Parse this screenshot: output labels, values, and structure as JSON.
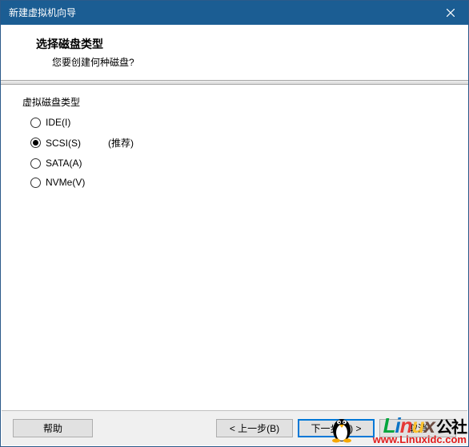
{
  "window": {
    "title": "新建虚拟机向导"
  },
  "header": {
    "title": "选择磁盘类型",
    "subtitle": "您要创建何种磁盘?"
  },
  "group": {
    "label": "虚拟磁盘类型"
  },
  "options": {
    "ide": {
      "label": "IDE(I)",
      "extra": "",
      "selected": false
    },
    "scsi": {
      "label": "SCSI(S)",
      "extra": "(推荐)",
      "selected": true
    },
    "sata": {
      "label": "SATA(A)",
      "extra": "",
      "selected": false
    },
    "nvme": {
      "label": "NVMe(V)",
      "extra": "",
      "selected": false
    }
  },
  "buttons": {
    "help": "帮助",
    "back": "< 上一步(B)",
    "next": "下一步(N) >",
    "cancel": "取消"
  },
  "watermark": {
    "brand_l": "L",
    "brand_i": "i",
    "brand_n": "n",
    "brand_u": "u",
    "brand_x": "x",
    "brand_cn": "公社",
    "url": "www.Linuxidc.com"
  }
}
